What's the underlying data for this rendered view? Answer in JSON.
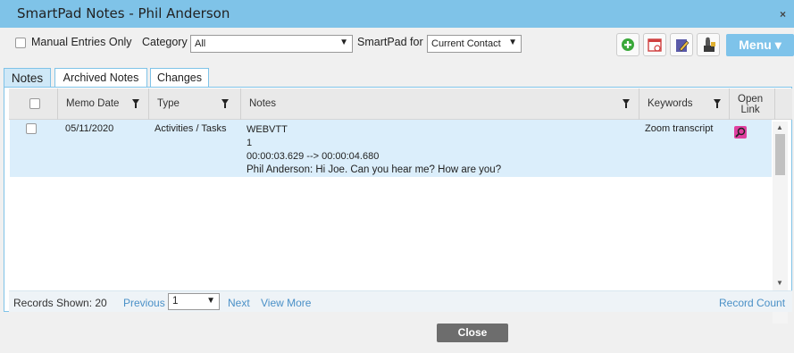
{
  "window": {
    "title": "SmartPad Notes - Phil Anderson",
    "close_glyph": "×"
  },
  "toolbar": {
    "manual_entries_label": "Manual Entries Only",
    "category_label": "Category",
    "category_value": "All",
    "smartpad_for_label": "SmartPad for",
    "smartpad_for_value": "Current Contact",
    "menu_label": "Menu ▾"
  },
  "tabs": [
    {
      "label": "Notes"
    },
    {
      "label": "Archived Notes"
    },
    {
      "label": "Changes"
    }
  ],
  "grid": {
    "columns": {
      "memo_date": "Memo Date",
      "type": "Type",
      "notes": "Notes",
      "keywords": "Keywords",
      "open_link": "Open\nLink"
    },
    "rows": [
      {
        "memo_date": "05/11/2020",
        "type": "Activities / Tasks",
        "notes_lines": [
          "WEBVTT",
          "1",
          "00:00:03.629 --> 00:00:04.680",
          "Phil Anderson: Hi Joe. Can you hear me? How are you?"
        ],
        "keywords": "Zoom transcript"
      }
    ]
  },
  "footer": {
    "records_shown": "Records Shown: 20",
    "previous": "Previous",
    "page_value": "1",
    "next": "Next",
    "view_more": "View More",
    "record_count": "Record Count"
  },
  "close_label": "Close",
  "icons": [
    "add-icon",
    "calendar-icon",
    "edit-note-icon",
    "import-icon",
    "magnifier-icon",
    "filter-icon",
    "dropdown-arrow-icon"
  ],
  "colors": {
    "titlebar": "#7fc3e8",
    "menu": "#7ec3ea",
    "row_selected": "#dbeefb",
    "link": "#4a90c7",
    "close_button": "#6d6d6d"
  }
}
